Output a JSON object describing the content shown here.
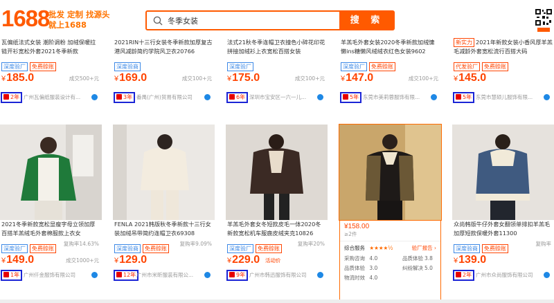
{
  "header": {
    "logo": "1688",
    "slogan_line1": "批发 定制 找源头",
    "slogan_line2": "就上1688",
    "search_value": "冬季女装",
    "search_button": "搜 索",
    "brand_color": "#ff5a00"
  },
  "top_row": [
    {
      "title": "瓦偏纸法式女装 潮阶调粉 加绒保暖拉链开衫宽松外套2021冬季新款",
      "tags": [
        "深度验厂",
        "免费赊账"
      ],
      "price": "185.0",
      "trade": "成交500+元",
      "year": "2年",
      "shop": "广州瓦偏纸服装设计有..."
    },
    {
      "title": "2021RIN十三行女装冬季新款加厚复古港风减龄简约学院风卫衣20766",
      "tags": [
        "深度验商"
      ],
      "price": "169.0",
      "trade": "成交100+元",
      "year": "3年",
      "shop": "番禺(广州)贸易有限公司"
    },
    {
      "title": "法式21秋冬季连帽卫衣撞色小碎花印花拼接加绒衫上衣宽松百搭女装",
      "tags": [
        "深度验厂"
      ],
      "price": "175.0",
      "trade": "成交100+元",
      "year": "6年",
      "shop": "深圳市宝安区一六一儿..."
    },
    {
      "title": "羊羔毛外套女装2020冬季新款加绒慵懒ins糖懒风绒绒衣红色女装9602",
      "tags": [
        "深度验厂",
        "免费赊账"
      ],
      "price": "147.0",
      "trade": "成交100+元",
      "year": "5年",
      "shop": "东莞市美莉蓉服饰有限..."
    },
    {
      "title": "2021年新款女装小香风厚羊羔毛减龄外套宽松流行百搭大码",
      "tags": [
        "代发验厂",
        "免费赊账"
      ],
      "price": "145.0",
      "trade": "",
      "year": "5年",
      "shop": "东莞市慧硕儿服饰有限...",
      "badge": "新实力"
    }
  ],
  "bottom_row": [
    {
      "title": "2021冬季新款宽松显瘦字母立领加厚百搭羊羔绒毛外套棉服款上衣女",
      "tags": [
        "深度验厂",
        "免费赊账"
      ],
      "price": "149.0",
      "trade": "复购率14.63%",
      "trade2": "成交1000+元",
      "year": "1年",
      "shop": "广州仟金服饰有限公司"
    },
    {
      "title": "FENLA 2021韩版秋冬季新款十三行女装加绒吊带简约连帽卫衣69308",
      "tags": [
        "深度验商",
        "免费赊账"
      ],
      "price": "129.0",
      "trade": "复购率9.09%",
      "year": "12年",
      "shop": "广州市米昕服装有限公..."
    },
    {
      "title": "羊羔毛外套女冬短款皮毛一体2020冬新款宽松机车服鹿皮绒夹克10826",
      "tags": [
        "深度验厂",
        "免费赊账"
      ],
      "price": "229.0",
      "trade": "复购率20%",
      "activity": "活动价",
      "year": "9年",
      "shop": "广州市韩迅服饰有限公司"
    },
    {
      "price": "158.00",
      "qty": "≥2件",
      "service": "综合服务",
      "stars": "★★★★½",
      "report": "验厂报告",
      "scores": [
        {
          "label": "采购咨询",
          "value": "4.0",
          "label2": "品质体验",
          "value2": "3.8"
        },
        {
          "label": "品质体验",
          "value": "3.0",
          "label2": "纠纷解决",
          "value2": "5.0"
        },
        {
          "label": "物流时效",
          "value": "4.0",
          "label2": "",
          "value2": ""
        }
      ]
    },
    {
      "title": "众尚韩版牛仔外套女翻领单排扣羊羔毛加厚短款保暖外套11300",
      "tags": [
        "深度验商",
        "免费赊账"
      ],
      "price": "139.0",
      "trade": "复购率",
      "year": "2年",
      "shop": "广州市众尚服饰有限公司"
    }
  ]
}
